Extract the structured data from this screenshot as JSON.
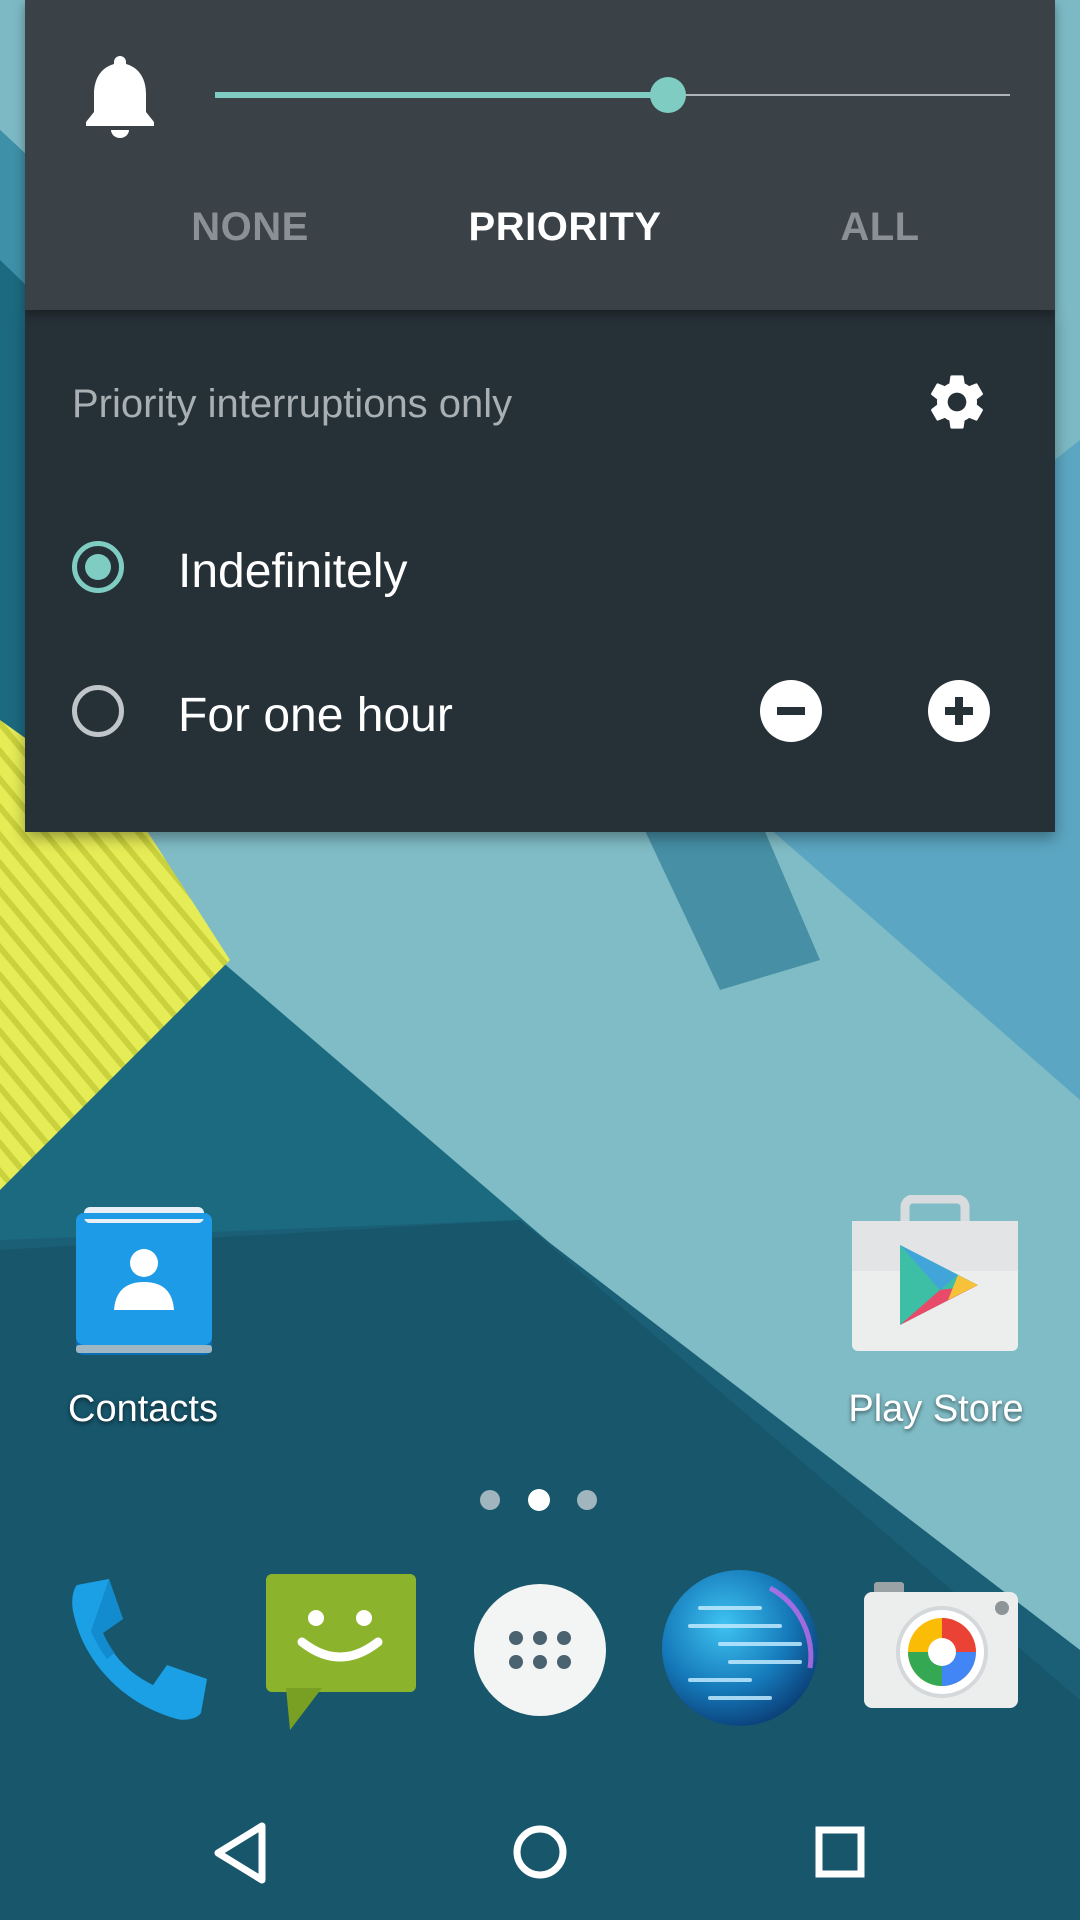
{
  "interruptions": {
    "volume_level": 0.57,
    "modes": [
      "NONE",
      "PRIORITY",
      "ALL"
    ],
    "selected_mode": "PRIORITY",
    "title": "Priority interruptions only",
    "options": [
      {
        "label": "Indefinitely",
        "selected": true
      },
      {
        "label": "For one hour",
        "selected": false
      }
    ]
  },
  "home": {
    "apps": [
      {
        "label": "Contacts",
        "icon": "contacts-icon"
      },
      {
        "label": "Play Store",
        "icon": "play-store-icon"
      }
    ],
    "page_indicator": {
      "pages": 3,
      "current": 2
    },
    "dock": [
      {
        "icon": "phone-icon"
      },
      {
        "icon": "messaging-icon"
      },
      {
        "icon": "app-drawer-icon"
      },
      {
        "icon": "browser-globe-icon"
      },
      {
        "icon": "camera-icon"
      }
    ]
  },
  "navigation": {
    "buttons": [
      "back-icon",
      "home-icon",
      "recents-icon"
    ]
  },
  "colors": {
    "accent": "#7fcdc2",
    "panel_top": "#3a4147",
    "panel_bottom": "#263037"
  }
}
